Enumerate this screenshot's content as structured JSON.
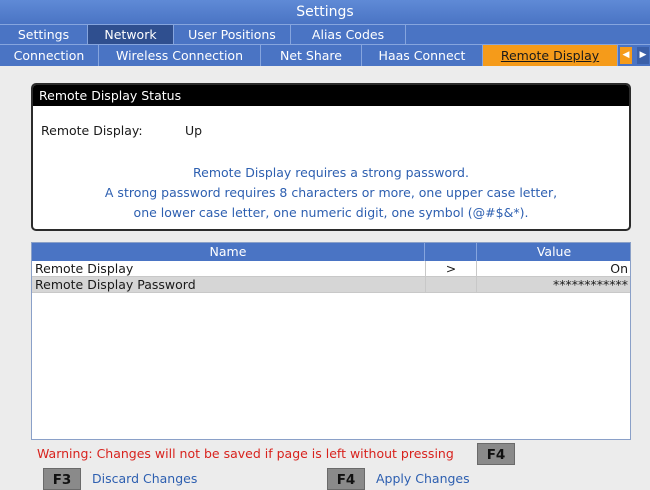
{
  "window": {
    "title": "Settings"
  },
  "tabs_primary": [
    {
      "label": "Settings"
    },
    {
      "label": "Network"
    },
    {
      "label": "User Positions"
    },
    {
      "label": "Alias Codes"
    }
  ],
  "tabs_secondary": [
    {
      "label": "Connection"
    },
    {
      "label": "Wireless Connection"
    },
    {
      "label": "Net Share"
    },
    {
      "label": "Haas Connect"
    },
    {
      "label": "Remote Display"
    }
  ],
  "scroll_left_icon": "◀",
  "scroll_right_icon": "▶",
  "status_panel": {
    "header": "Remote Display Status",
    "label": "Remote Display:",
    "value": "Up",
    "message": [
      "Remote Display requires a strong password.",
      "A strong password requires 8 characters or more, one upper case letter,",
      "one lower case letter, one numeric digit, one symbol (@#$&*)."
    ]
  },
  "table": {
    "columns": {
      "name": "Name",
      "value": "Value"
    },
    "rows": [
      {
        "name": "Remote Display",
        "arrow": ">",
        "value": "On"
      },
      {
        "name": "Remote Display Password",
        "arrow": "",
        "value": "************"
      }
    ]
  },
  "footer": {
    "warning": "Warning: Changes will not be saved if page is left without pressing",
    "warning_key": "F4",
    "f3_key": "F3",
    "f3_label": "Discard Changes",
    "f4_key": "F4",
    "f4_label": "Apply Changes"
  },
  "colors": {
    "tab_blue": "#4a74c4",
    "active_tab_orange": "#f59b1a",
    "message_blue": "#2d5fb0",
    "warning_red": "#d8221d"
  }
}
